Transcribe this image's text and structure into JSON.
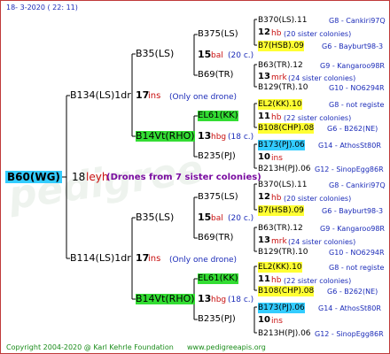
{
  "header": {
    "date": "18-  3-2020 (  22: 11)"
  },
  "footer": {
    "copyright": "Copyright 2004-2020 @ Karl Kehrle Foundation",
    "url": "www.pedigreeapis.org"
  },
  "colors": {
    "frame": "#c03a3a",
    "blue_box": "#33ccff",
    "yellow_box": "#ffff33",
    "green_box": "#33dd33",
    "link_blue": "#1b2bb8",
    "ins_red": "#c81010",
    "drones_purple": "#7a0ca0",
    "footer_green": "#1a8c1a"
  },
  "root": {
    "id": "B60(WG)",
    "num": "18",
    "code": "leyh",
    "note": "(Drones from 7 sister colonies)"
  },
  "gen1": [
    {
      "id": "B134(LS)1dr",
      "num": "17",
      "code": "ins",
      "note": "(Only one drone)"
    },
    {
      "id": "B114(LS)1dr",
      "num": "17",
      "code": "ins",
      "note": "(Only one drone)"
    }
  ],
  "gen2": [
    {
      "id": "B35(LS)",
      "num": "15",
      "code": "bal",
      "note": "(20 c.)"
    },
    {
      "id": "B14Vt(RHO)",
      "num": "13",
      "code": "hbg",
      "note": "(18 c.)"
    },
    {
      "id": "B35(LS)",
      "num": "15",
      "code": "bal",
      "note": "(20 c.)"
    },
    {
      "id": "B14Vt(RHO)",
      "num": "13",
      "code": "hbg",
      "note": "(18 c.)"
    }
  ],
  "gen3": [
    {
      "id": "B375(LS)",
      "num": "12",
      "code": "hb",
      "note": "(20 sister colonies)"
    },
    {
      "id": "B69(TR)",
      "num": "13",
      "code": "mrk",
      "note": "(24 sister colonies)"
    },
    {
      "id": "EL61(KK)",
      "num": "11",
      "code": "hb",
      "note": "(22 sister colonies)"
    },
    {
      "id": "B235(PJ)",
      "num": "10",
      "code": "ins",
      "note": ""
    },
    {
      "id": "B375(LS)",
      "num": "12",
      "code": "hb",
      "note": "(20 sister colonies)"
    },
    {
      "id": "B69(TR)",
      "num": "13",
      "code": "mrk",
      "note": "(24 sister colonies)"
    },
    {
      "id": "EL61(KK)",
      "num": "11",
      "code": "hb",
      "note": "(22 sister colonies)"
    },
    {
      "id": "B235(PJ)",
      "num": "10",
      "code": "ins",
      "note": ""
    }
  ],
  "gen4": [
    {
      "id": "B370(LS).11",
      "right": "G8 - Cankiri97Q"
    },
    {
      "id": "B7(HSB).09",
      "right": "G6 - Bayburt98-3"
    },
    {
      "id": "B63(TR).12",
      "right": "G9 - Kangaroo98R"
    },
    {
      "id": "B129(TR).10",
      "right": "G10 - NO6294R"
    },
    {
      "id": "EL2(KK).10",
      "right": "G8 - not registe"
    },
    {
      "id": "B108(CHP).08",
      "right": "G6 - B262(NE)"
    },
    {
      "id": "B173(PJ).06",
      "right": "G14 - AthosSt80R"
    },
    {
      "id": "B213H(PJ).06",
      "right": "G12 - SinopEgg86R"
    },
    {
      "id": "B370(LS).11",
      "right": "G8 - Cankiri97Q"
    },
    {
      "id": "B7(HSB).09",
      "right": "G6 - Bayburt98-3"
    },
    {
      "id": "B63(TR).12",
      "right": "G9 - Kangaroo98R"
    },
    {
      "id": "B129(TR).10",
      "right": "G10 - NO6294R"
    },
    {
      "id": "EL2(KK).10",
      "right": "G8 - not registe"
    },
    {
      "id": "B108(CHP).08",
      "right": "G6 - B262(NE)"
    },
    {
      "id": "B173(PJ).06",
      "right": "G14 - AthosSt80R"
    },
    {
      "id": "B213H(PJ).06",
      "right": "G12 - SinopEgg86R"
    }
  ]
}
